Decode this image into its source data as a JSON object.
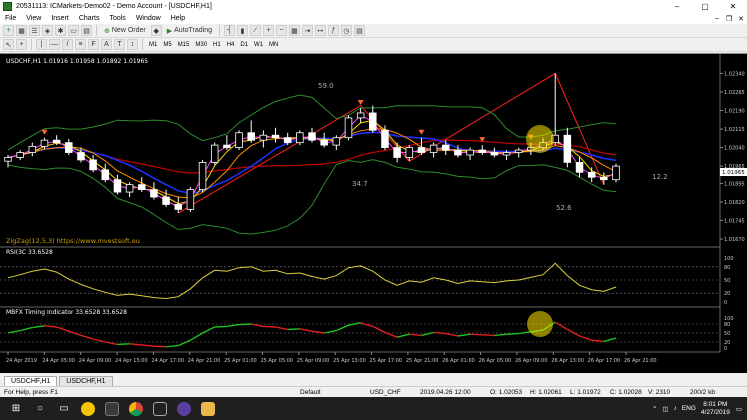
{
  "window": {
    "title": "20531113: ICMarkets-Demo02 - Demo Account - [USDCHF,H1]"
  },
  "menu": [
    "File",
    "View",
    "Insert",
    "Charts",
    "Tools",
    "Window",
    "Help"
  ],
  "toolbar": {
    "new_order": "New Order",
    "autotrading": "AutoTrading",
    "timeframes": [
      "M1",
      "M5",
      "M15",
      "M30",
      "H1",
      "H4",
      "D1",
      "W1",
      "MN"
    ]
  },
  "chart": {
    "header": "USDCHF,H1  1.01916 1.01958 1.01892 1.01965",
    "watermark": "ZigZag(12,5,3) https://www.mvestsoft.eu",
    "annotations": [
      "59.0",
      "34.7",
      "12.2",
      "52.6"
    ],
    "price_labels": [
      "1.02340",
      "1.02265",
      "1.02190",
      "1.02115",
      "1.02040",
      "1.01965",
      "1.01895",
      "1.01820",
      "1.01745",
      "1.01670"
    ],
    "current_price": "1.01965",
    "rsi_header": "RSI(3C 33.6528",
    "rsi_levels": [
      "100",
      "80",
      "50",
      "20",
      "0"
    ],
    "timing_header": "MBFX Timing Indicator 33.6528 33.6528",
    "timing_levels": [
      "100",
      "80",
      "50",
      "20",
      "0"
    ],
    "time_labels": [
      "24 Apr 2019",
      "24 Apr 05:00",
      "24 Apr 09:00",
      "24 Apr 13:00",
      "24 Apr 17:00",
      "24 Apr 21:00",
      "25 Apr 01:00",
      "25 Apr 05:00",
      "25 Apr 09:00",
      "25 Apr 13:00",
      "25 Apr 17:00",
      "25 Apr 21:00",
      "26 Apr 01:00",
      "26 Apr 05:00",
      "26 Apr 09:00",
      "26 Apr 13:00",
      "26 Apr 17:00",
      "26 Apr 21:00"
    ],
    "candles": [
      [
        1.01985,
        1.0201,
        1.0196,
        1.02
      ],
      [
        1.02,
        1.0203,
        1.0199,
        1.0202
      ],
      [
        1.0202,
        1.0206,
        1.02005,
        1.02045
      ],
      [
        1.02045,
        1.0208,
        1.02035,
        1.0207
      ],
      [
        1.0207,
        1.0209,
        1.0205,
        1.0206
      ],
      [
        1.0206,
        1.02075,
        1.0201,
        1.0202
      ],
      [
        1.0202,
        1.0204,
        1.0198,
        1.0199
      ],
      [
        1.0199,
        1.0201,
        1.0194,
        1.0195
      ],
      [
        1.0195,
        1.01975,
        1.019,
        1.0191
      ],
      [
        1.0191,
        1.0193,
        1.0185,
        1.0186
      ],
      [
        1.0186,
        1.019,
        1.0184,
        1.0189
      ],
      [
        1.0189,
        1.0192,
        1.0186,
        1.0187
      ],
      [
        1.0187,
        1.019,
        1.0183,
        1.0184
      ],
      [
        1.0184,
        1.0187,
        1.018,
        1.0181
      ],
      [
        1.0181,
        1.0184,
        1.01775,
        1.0179
      ],
      [
        1.0179,
        1.0188,
        1.0178,
        1.0187
      ],
      [
        1.0187,
        1.0199,
        1.0186,
        1.0198
      ],
      [
        1.0198,
        1.0206,
        1.0197,
        1.0205
      ],
      [
        1.0205,
        1.0209,
        1.0203,
        1.0204
      ],
      [
        1.0204,
        1.0211,
        1.0203,
        1.021
      ],
      [
        1.021,
        1.0215,
        1.0206,
        1.0207
      ],
      [
        1.0207,
        1.0211,
        1.0204,
        1.0209
      ],
      [
        1.0209,
        1.0212,
        1.0206,
        1.0208
      ],
      [
        1.0208,
        1.021,
        1.0205,
        1.0206
      ],
      [
        1.0206,
        1.0211,
        1.0205,
        1.021
      ],
      [
        1.021,
        1.0212,
        1.0206,
        1.0207
      ],
      [
        1.0207,
        1.021,
        1.0204,
        1.0205
      ],
      [
        1.0205,
        1.0209,
        1.0203,
        1.0208
      ],
      [
        1.0208,
        1.0217,
        1.0207,
        1.0216
      ],
      [
        1.0216,
        1.022,
        1.0214,
        1.0218
      ],
      [
        1.0218,
        1.0221,
        1.021,
        1.0211
      ],
      [
        1.0211,
        1.0213,
        1.0203,
        1.0204
      ],
      [
        1.0204,
        1.0206,
        1.0198,
        1.02
      ],
      [
        1.02,
        1.0205,
        1.01985,
        1.0204
      ],
      [
        1.0204,
        1.0208,
        1.0201,
        1.0202
      ],
      [
        1.0202,
        1.0206,
        1.02,
        1.0205
      ],
      [
        1.0205,
        1.0207,
        1.0201,
        1.0203
      ],
      [
        1.0203,
        1.0205,
        1.02,
        1.0201
      ],
      [
        1.0201,
        1.0204,
        1.0199,
        1.0203
      ],
      [
        1.0203,
        1.0205,
        1.0201,
        1.0202
      ],
      [
        1.0202,
        1.0204,
        1.02,
        1.0201
      ],
      [
        1.0201,
        1.0203,
        1.0199,
        1.0202
      ],
      [
        1.0202,
        1.0204,
        1.02,
        1.0203
      ],
      [
        1.0203,
        1.0206,
        1.0201,
        1.0204
      ],
      [
        1.0204,
        1.0208,
        1.0203,
        1.0206
      ],
      [
        1.0206,
        1.0234,
        1.0205,
        1.0209
      ],
      [
        1.0209,
        1.0212,
        1.0196,
        1.0198
      ],
      [
        1.0198,
        1.02,
        1.0192,
        1.0194
      ],
      [
        1.0194,
        1.0196,
        1.019,
        1.0192
      ],
      [
        1.0192,
        1.0194,
        1.0189,
        1.0191
      ],
      [
        1.0191,
        1.01975,
        1.019,
        1.01965
      ]
    ]
  },
  "tabs": [
    "USDCHF,H1",
    "USDCHF,H1"
  ],
  "status": {
    "help": "For Help, press F1",
    "profile": "Default",
    "symbol": "USD_CHF",
    "time": "2019.04.26 12:00",
    "open": "O: 1.02053",
    "high": "H: 1.02061",
    "low": "L: 1.01972",
    "close": "C: 1.02028",
    "volume": "V: 2310",
    "traffic": "200/2 kb"
  },
  "taskbar": {
    "lang": "ENG",
    "time": "8:01 PM",
    "date": "4/27/2019"
  }
}
